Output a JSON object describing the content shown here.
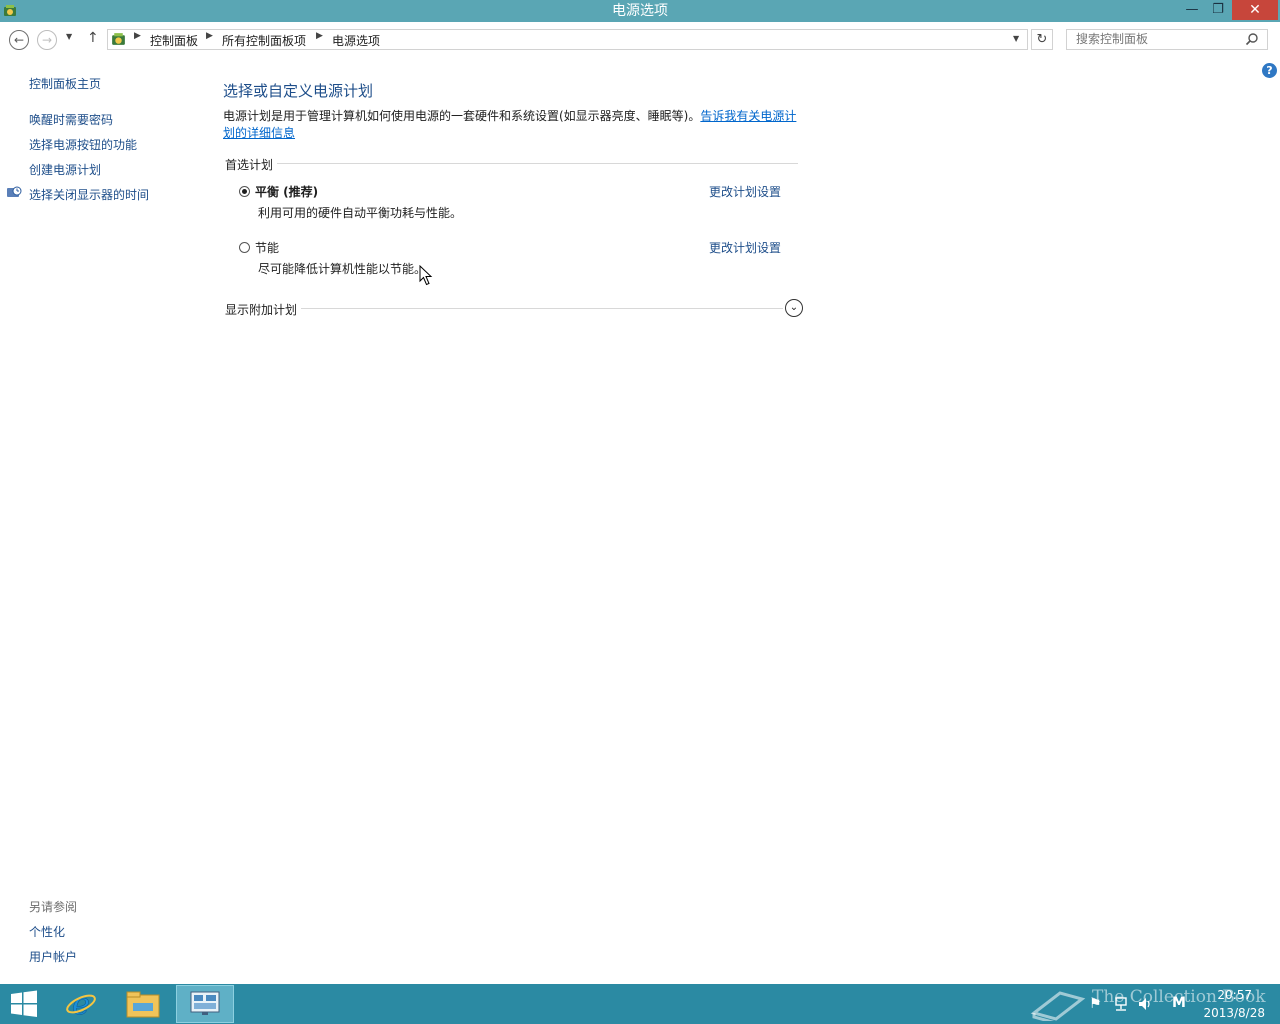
{
  "window": {
    "title": "电源选项"
  },
  "address": {
    "breadcrumbs": [
      "控制面板",
      "所有控制面板项",
      "电源选项"
    ]
  },
  "search": {
    "placeholder": "搜索控制面板"
  },
  "sidebar": {
    "home": "控制面板主页",
    "links": [
      "唤醒时需要密码",
      "选择电源按钮的功能",
      "创建电源计划",
      "选择关闭显示器的时间"
    ],
    "see_also": {
      "heading": "另请参阅",
      "links": [
        "个性化",
        "用户帐户"
      ]
    }
  },
  "main": {
    "heading": "选择或自定义电源计划",
    "description": "电源计划是用于管理计算机如何使用电源的一套硬件和系统设置(如显示器亮度、睡眠等)。",
    "description_link": "告诉我有关电源计划的详细信息",
    "preferred_label": "首选计划",
    "plans": [
      {
        "name": "平衡 (推荐)",
        "desc": "利用可用的硬件自动平衡功耗与性能。",
        "selected": true,
        "change": "更改计划设置"
      },
      {
        "name": "节能",
        "desc": "尽可能降低计算机性能以节能。",
        "selected": false,
        "change": "更改计划设置"
      }
    ],
    "additional_label": "显示附加计划"
  },
  "taskbar": {
    "time": "20:57",
    "date": "2013/8/28",
    "watermark": "The Collection Book",
    "tray_letter": "M"
  },
  "colors": {
    "titlebar": "#5aa6b4",
    "taskbar": "#2b8aa3",
    "link": "#1e4e8a",
    "close": "#c7463b"
  }
}
